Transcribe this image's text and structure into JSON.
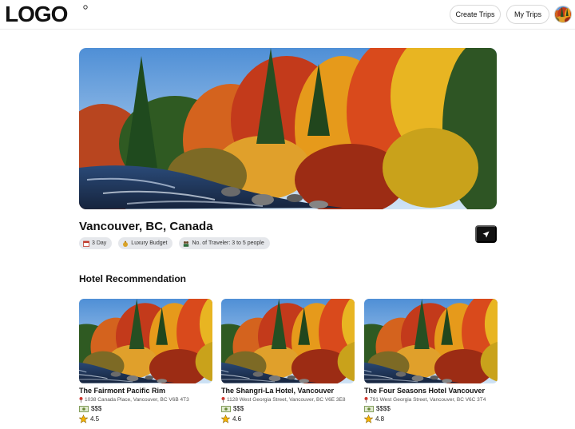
{
  "header": {
    "logo_text": "LOGO",
    "create_trips_label": "Create Trips",
    "my_trips_label": "My Trips"
  },
  "trip": {
    "destination": "Vancouver, BC, Canada",
    "tags": [
      {
        "icon": "calendar-icon",
        "label": "3 Day"
      },
      {
        "icon": "money-bag-icon",
        "label": "Luxury Budget"
      },
      {
        "icon": "people-icon",
        "label": "No. of Traveler: 3 to 5 people"
      }
    ]
  },
  "hotels": {
    "section_title": "Hotel Recommendation",
    "items": [
      {
        "name": "The Fairmont Pacific Rim",
        "address": "1038 Canada Place, Vancouver, BC V6B 4T3",
        "price": "$$$",
        "rating": "4.5"
      },
      {
        "name": "The Shangri-La Hotel, Vancouver",
        "address": "1128 West Georgia Street, Vancouver, BC V6E 3E8",
        "price": "$$$",
        "rating": "4.6"
      },
      {
        "name": "The Four Seasons Hotel Vancouver",
        "address": "791 West Georgia Street, Vancouver, BC V6C 3T4",
        "price": "$$$$",
        "rating": "4.8"
      }
    ]
  },
  "colors": {
    "accent": "#111111",
    "tag_bg": "#e5e7eb",
    "star": "#f5b301"
  }
}
